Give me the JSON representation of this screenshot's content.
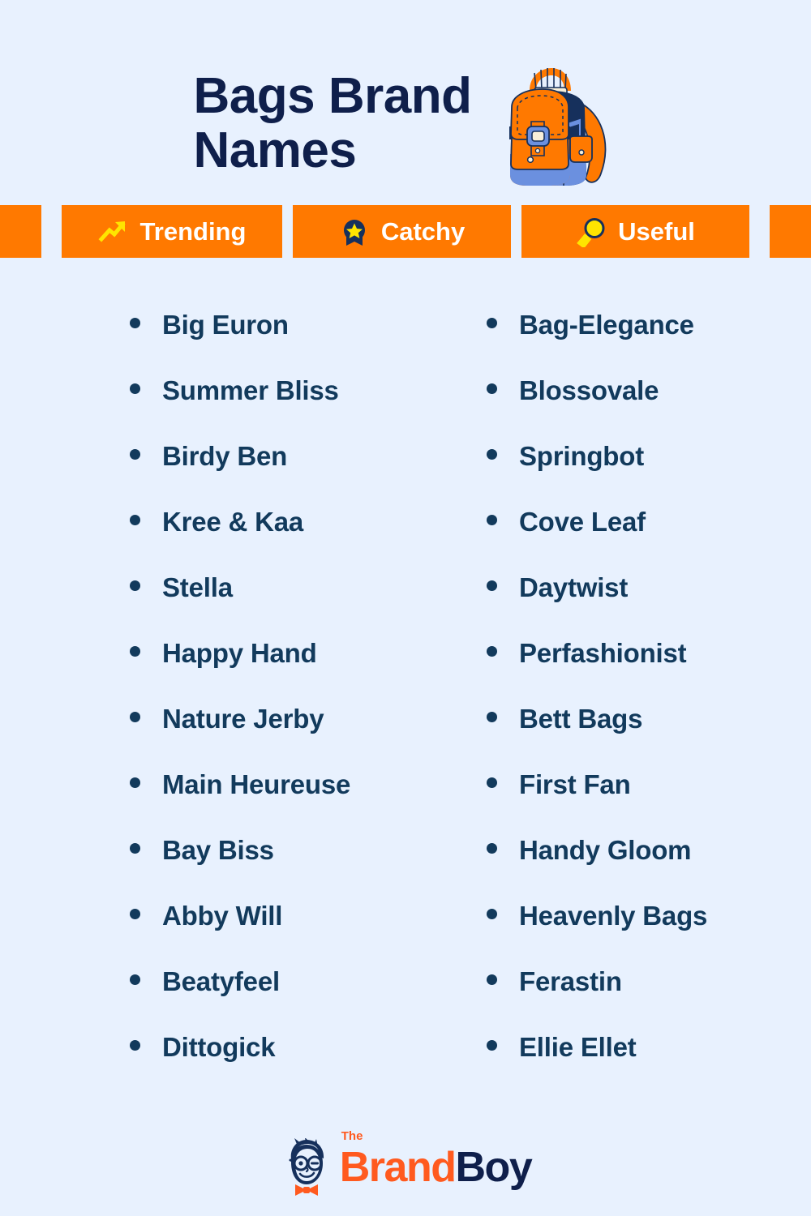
{
  "page": {
    "background_color": "#e8f1fe",
    "title": "Bags Brand Names",
    "title_color": "#0f1f4b",
    "accent_color": "#ff7900",
    "text_color": "#123a5c"
  },
  "header": {
    "title_line1": "Bags Brand",
    "title_line2": "Names",
    "illustration": "backpack-illustration"
  },
  "badges": [
    {
      "label": "Trending",
      "icon": "trending-arrow-icon"
    },
    {
      "label": "Catchy",
      "icon": "award-medal-star-icon"
    },
    {
      "label": "Useful",
      "icon": "magnifier-icon"
    }
  ],
  "names": {
    "left_column": [
      "Big Euron",
      "Summer Bliss",
      "Birdy Ben",
      "Kree & Kaa",
      "Stella",
      "Happy Hand",
      "Nature Jerby",
      "Main Heureuse",
      "Bay Biss",
      "Abby Will",
      "Beatyfeel",
      "Dittogick"
    ],
    "right_column": [
      "Bag-Elegance",
      "Blossovale",
      "Springbot",
      "Cove Leaf",
      "Daytwist",
      "Perfashionist",
      "Bett Bags",
      "First Fan",
      "Handy Gloom",
      "Heavenly Bags",
      "Ferastin",
      "Ellie Ellet"
    ]
  },
  "footer": {
    "logo_the": "The",
    "logo_brand": "Brand",
    "logo_boy": "Boy",
    "logo_mark": "brandboy-mascot-icon",
    "brand_color": "#ff5a1f",
    "boy_color": "#0f1f4b"
  }
}
